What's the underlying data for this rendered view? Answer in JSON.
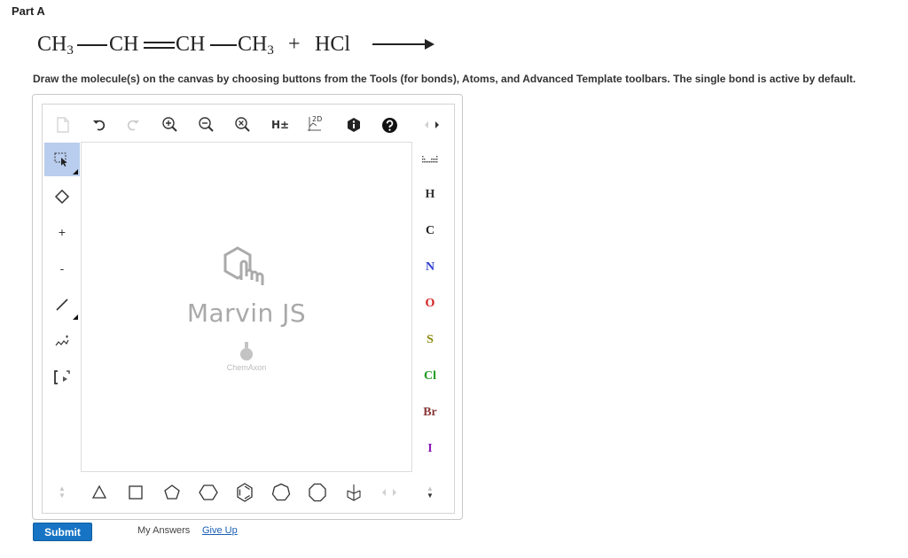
{
  "part_title": "Part A",
  "equation": {
    "segments": [
      "CH",
      "3",
      "CH",
      "CH",
      "CH",
      "3",
      "+",
      "HCl"
    ]
  },
  "instructions": "Draw the molecule(s) on the canvas by choosing buttons from the Tools (for bonds), Atoms, and Advanced Template toolbars. The single bond is active by default.",
  "editor": {
    "canvas_title": "Marvin JS",
    "canvas_brand": "ChemAxon",
    "top_toolbar": [
      {
        "icon": "new-document-icon"
      },
      {
        "icon": "undo-icon"
      },
      {
        "icon": "redo-icon"
      },
      {
        "icon": "zoom-in-icon"
      },
      {
        "icon": "zoom-out-icon"
      },
      {
        "icon": "zoom-reset-icon"
      },
      {
        "icon": "explicit-hydrogens-icon",
        "label": "H±"
      },
      {
        "icon": "clean-2d-icon",
        "label": "2D"
      },
      {
        "icon": "info-icon"
      },
      {
        "icon": "help-icon"
      }
    ],
    "left_toolbar": [
      {
        "icon": "selection-icon",
        "active": true
      },
      {
        "icon": "eraser-icon"
      },
      {
        "icon": "positive-charge-icon",
        "label": "+"
      },
      {
        "icon": "negative-charge-icon",
        "label": "-"
      },
      {
        "icon": "single-bond-icon"
      },
      {
        "icon": "chain-icon"
      },
      {
        "icon": "bracket-icon"
      }
    ],
    "atoms": [
      {
        "symbol": "H",
        "color": "#333333"
      },
      {
        "symbol": "C",
        "color": "#222222"
      },
      {
        "symbol": "N",
        "color": "#2c3ccf"
      },
      {
        "symbol": "O",
        "color": "#d52020"
      },
      {
        "symbol": "S",
        "color": "#8a8a10"
      },
      {
        "symbol": "Cl",
        "color": "#1f9a1f"
      },
      {
        "symbol": "Br",
        "color": "#8b3a3a"
      },
      {
        "symbol": "I",
        "color": "#8a1ab8"
      }
    ],
    "templates": [
      {
        "icon": "cyclopropane-icon"
      },
      {
        "icon": "cyclobutane-icon"
      },
      {
        "icon": "cyclopentane-icon"
      },
      {
        "icon": "cyclohexane-icon"
      },
      {
        "icon": "benzene-icon"
      },
      {
        "icon": "cycloheptane-icon"
      },
      {
        "icon": "cyclooctane-icon"
      },
      {
        "icon": "bicyclo-template-icon"
      }
    ]
  },
  "footer": {
    "submit_label": "Submit",
    "my_answers_label": "My Answers",
    "give_up_label": "Give Up"
  }
}
